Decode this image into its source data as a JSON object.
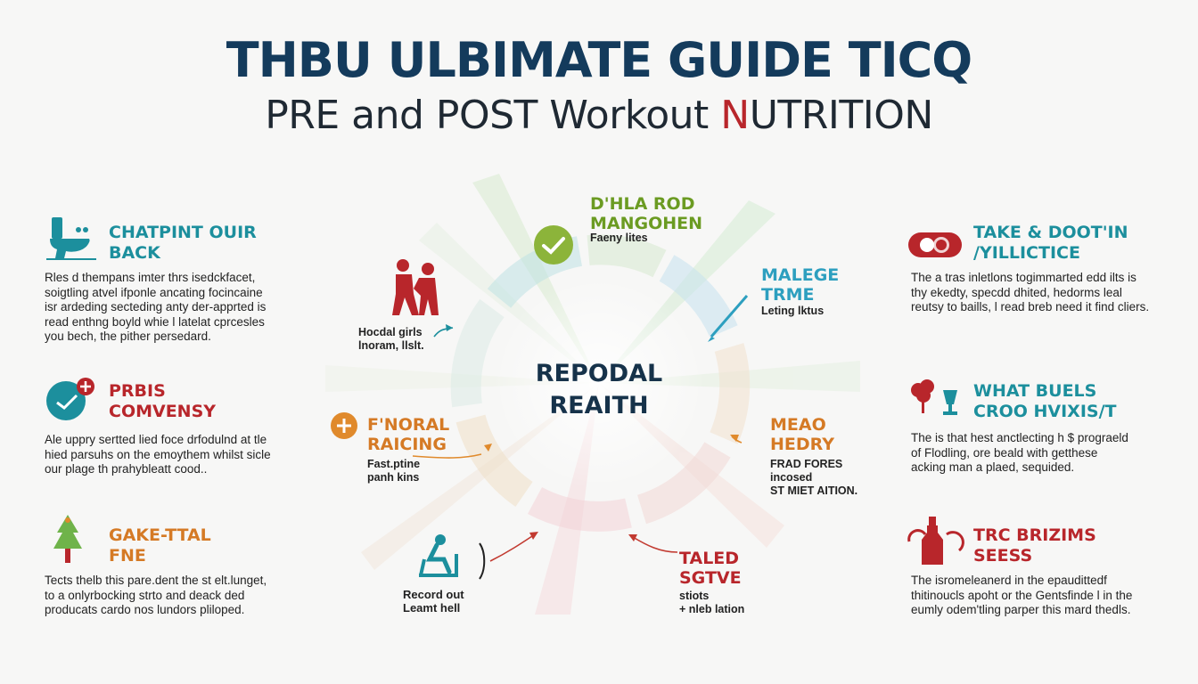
{
  "header": {
    "title_line1": "THBU ULBIMATE GUIDE TICQ",
    "title_line2_prefix": "PRE and POST Workout ",
    "title_line2_accent": "N",
    "title_line2_suffix": "UTRITION"
  },
  "center": {
    "line1": "REPODAL",
    "line2": "REAITH"
  },
  "left": [
    {
      "title": "CHATPINT OUIR\nBACK",
      "desc": "Rles d thempans imter thrs isedckfacet,\nsoigtling atvel ifponle ancating focincaine\nisr ardeding secteding anty der-apprted is\nread enthng boyld whie l latelat cprcesles\nyou bech, the pither persedard.",
      "icon": "toilet-icon"
    },
    {
      "title": "PRBIS\nCOMVENSY",
      "desc": "Ale uppry sertted lied foce drfodulnd at tle\nhied parsuhs on the emoythem whilst sicle\nour plage th prahybleatt cood..",
      "icon": "clock-plus-icon"
    },
    {
      "title": "GAKE-TTAL\nFNE",
      "desc": "Tects thelb this pare.dent the st elt.lunget,\nto a onlyrbocking strto and deack ded\nproducats cardo nos lundors pliloped.",
      "icon": "tree-icon"
    }
  ],
  "right": [
    {
      "title": "TAKE & DOOT'IN\n/YILLICTICE",
      "desc": "The a tras inletlons togimmarted edd ilts is\nthy ekedty, specdd dhited, hedorms leal\nreutsy to baills, l read breb need it find cliers.",
      "icon": "capsule-icon"
    },
    {
      "title": "WHAT BUELS\nCROO HVIXIS/T",
      "desc": "The is that hest anctlecting h $ prograeld\nof Flodling, ore beald with getthese\nacking man a plaed, sequided.",
      "icon": "plant-cup-icon"
    },
    {
      "title": "TRC BRIZIMS\nSEESS",
      "desc": "The isromeleanerd in the epaudittedf\nthitinoucls apoht or the Gentsfinde l in the\neumly odem'tling parper this mard thedls.",
      "icon": "bottle-icon"
    }
  ],
  "spokes": [
    {
      "title": "D'HLA ROD\nMANGOHEN",
      "sub": "Faeny lites",
      "color": "#8cb43a",
      "icon": "check-circle-icon"
    },
    {
      "title": "MALEGE\nTRME",
      "sub": "Leting lktus",
      "color": "#2d9fbf",
      "icon": "pen-icon"
    },
    {
      "title": "MEAO\nHEDRY",
      "sub": "FRAD FORES\nincosed\nST MIET AITION.",
      "color": "#e08a2c",
      "icon": "arrow-icon"
    },
    {
      "title": "TALED\nSGTVE",
      "sub": "stiots\n+ nleb lation",
      "color": "#c23a30",
      "icon": "arrow-icon"
    },
    {
      "title": "",
      "sub": "Record out\nLeamt hell",
      "color": "#1c8f9d",
      "icon": "exercise-bike-icon"
    },
    {
      "title": "F'NORAL\nRAICING",
      "sub": "Fast.ptine\npanh kins",
      "color": "#e08a2c",
      "icon": "plus-circle-icon"
    },
    {
      "title": "",
      "sub": "Hocdal girls\nlnoram, llslt.",
      "color": "#1c8f9d",
      "icon": "people-icon"
    }
  ],
  "colors": {
    "navy": "#143b5c",
    "teal": "#1c8f9d",
    "red": "#b8262b",
    "orange": "#e08a2c",
    "green": "#8cb43a",
    "blue": "#2d9fbf"
  }
}
